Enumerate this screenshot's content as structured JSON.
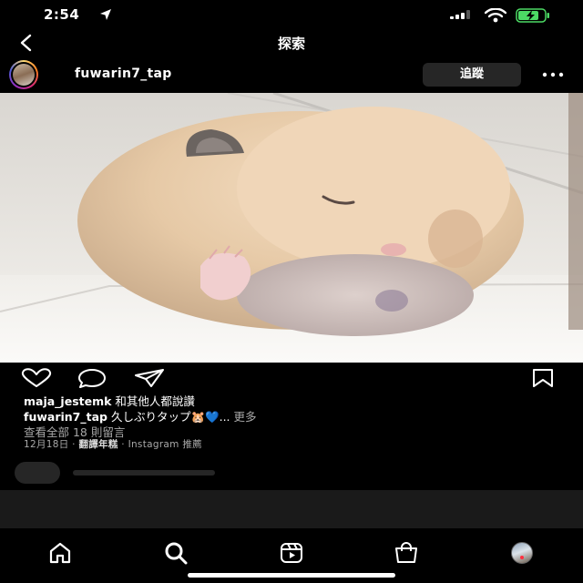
{
  "status_bar": {
    "time": "2:54",
    "location_icon": "location-arrow-icon",
    "signal_icon": "cellular-signal-icon",
    "wifi_icon": "wifi-icon",
    "battery_icon": "battery-charging-icon",
    "battery_color": "#4cd964"
  },
  "header": {
    "title": "探索",
    "back_icon": "chevron-left-icon"
  },
  "post": {
    "username": "fuwarin7_tap",
    "follow_label": "追蹤",
    "more_icon": "ellipsis-icon",
    "image_subject": "sleeping hamster",
    "likes_user": "maja_jestemk",
    "likes_suffix": "和其他人都說讚",
    "caption_user": "fuwarin7_tap",
    "caption_text": "久しぶりタップ🐹💙...",
    "caption_more": "更多",
    "view_comments": "查看全部 18 則留言",
    "date": "12月18日",
    "translate": "翻譯年糕",
    "source": "Instagram 推薦",
    "meta_separator": "·"
  },
  "actions": {
    "like_icon": "heart-icon",
    "comment_icon": "comment-bubble-icon",
    "share_icon": "paper-plane-icon",
    "save_icon": "bookmark-icon"
  },
  "tabbar": {
    "items": [
      "home-icon",
      "search-icon",
      "reels-icon",
      "shop-icon",
      "profile-avatar"
    ],
    "notification_color": "#ff3040"
  },
  "colors": {
    "background": "#000000",
    "secondary_text": "#a8a8a8",
    "button_bg": "#262626"
  }
}
